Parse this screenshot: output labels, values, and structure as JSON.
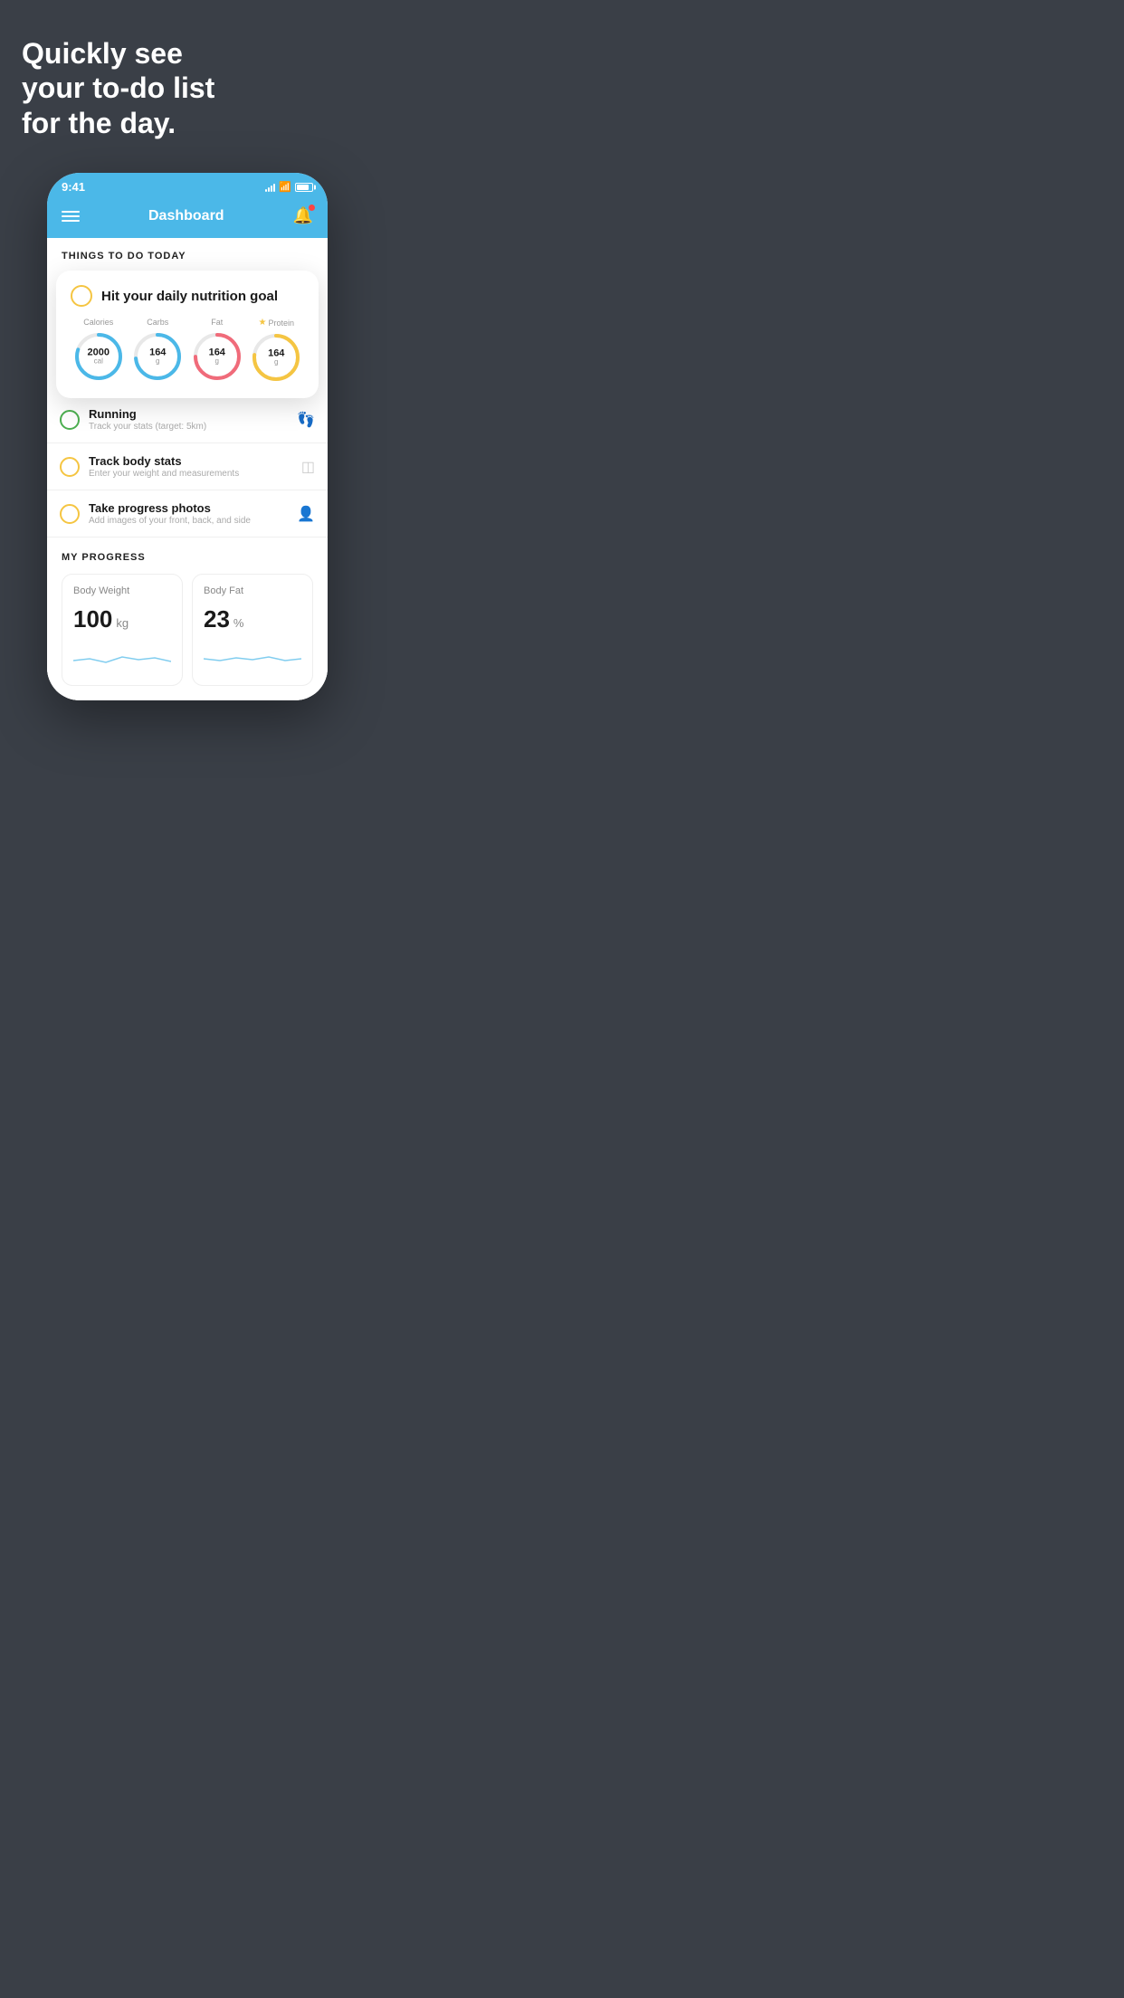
{
  "headline": "Quickly see\nyour to-do list\nfor the day.",
  "status": {
    "time": "9:41"
  },
  "header": {
    "title": "Dashboard"
  },
  "section_heading": "THINGS TO DO TODAY",
  "nutrition_card": {
    "title": "Hit your daily nutrition goal",
    "items": [
      {
        "label": "Calories",
        "value": "2000",
        "unit": "cal",
        "color": "#4bb8e8",
        "stroke_dash": "88",
        "stroke_offset": "22"
      },
      {
        "label": "Carbs",
        "value": "164",
        "unit": "g",
        "color": "#4bb8e8",
        "stroke_dash": "88",
        "stroke_offset": "30"
      },
      {
        "label": "Fat",
        "value": "164",
        "unit": "g",
        "color": "#f06b7a",
        "stroke_dash": "88",
        "stroke_offset": "28"
      },
      {
        "label": "Protein",
        "value": "164",
        "unit": "g",
        "color": "#f5c542",
        "stroke_dash": "88",
        "stroke_offset": "25",
        "starred": true
      }
    ]
  },
  "list_items": [
    {
      "title": "Running",
      "subtitle": "Track your stats (target: 5km)",
      "circle_color": "green",
      "icon": "👟"
    },
    {
      "title": "Track body stats",
      "subtitle": "Enter your weight and measurements",
      "circle_color": "yellow",
      "icon": "⚖️"
    },
    {
      "title": "Take progress photos",
      "subtitle": "Add images of your front, back, and side",
      "circle_color": "yellow",
      "icon": "👤"
    }
  ],
  "progress": {
    "heading": "MY PROGRESS",
    "cards": [
      {
        "title": "Body Weight",
        "value": "100",
        "unit": "kg"
      },
      {
        "title": "Body Fat",
        "value": "23",
        "unit": "%"
      }
    ]
  }
}
